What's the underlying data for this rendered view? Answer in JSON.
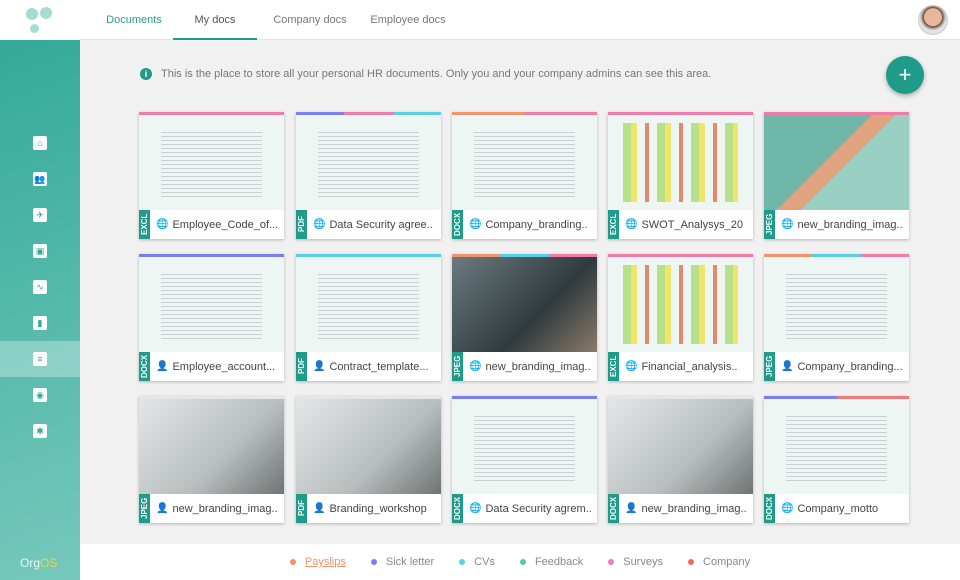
{
  "app": {
    "brand_prefix": "Org",
    "brand_suffix": "OS"
  },
  "header": {
    "section": "Documents",
    "tabs": [
      {
        "label": "My docs",
        "active": true
      },
      {
        "label": "Company docs"
      },
      {
        "label": "Employee docs"
      }
    ]
  },
  "sidebar": {
    "items": [
      {
        "icon": "home-icon"
      },
      {
        "icon": "people-icon"
      },
      {
        "icon": "airplane-icon"
      },
      {
        "icon": "dashboard-icon"
      },
      {
        "icon": "activity-icon"
      },
      {
        "icon": "bar-chart-icon"
      },
      {
        "icon": "documents-icon",
        "active": true
      },
      {
        "icon": "id-badge-icon"
      },
      {
        "icon": "settings-icon"
      }
    ]
  },
  "info": {
    "text": "This is the place to store all your personal HR documents. Only you and your company admins can see this area."
  },
  "add_button": "+",
  "cards": [
    {
      "type": "EXCL",
      "scope": "globe",
      "name": "Employee_Code_of...",
      "thumb": "document",
      "bars": [
        "#f07aa8"
      ]
    },
    {
      "type": "PDF",
      "scope": "globe",
      "name": "Data Security agree..",
      "thumb": "document",
      "bars": [
        "#7b7ef0",
        "#f07aa8",
        "#5ccfe6"
      ]
    },
    {
      "type": "DOCX",
      "scope": "globe",
      "name": "Company_branding..",
      "thumb": "document",
      "bars": [
        "#f0946b",
        "#f07aa8"
      ]
    },
    {
      "type": "EXCL",
      "scope": "globe",
      "name": "SWOT_Analysys_20",
      "thumb": "spreadsheet",
      "bars": [
        "#f07aa8"
      ]
    },
    {
      "type": "JPEG",
      "scope": "globe",
      "name": "new_branding_imag..",
      "thumb": "graphic",
      "bars": [
        "#f07aa8"
      ]
    },
    {
      "type": "DOCX",
      "scope": "person",
      "name": "Employee_account...",
      "thumb": "document",
      "bars": [
        "#7b7ef0"
      ]
    },
    {
      "type": "PDF",
      "scope": "person",
      "name": "Contract_template...",
      "thumb": "document",
      "bars": [
        "#5ccfe6"
      ]
    },
    {
      "type": "JPEG",
      "scope": "globe",
      "name": "new_branding_imag..",
      "thumb": "photo",
      "bars": [
        "#f0946b",
        "#5ccfe6",
        "#f07aa8"
      ]
    },
    {
      "type": "EXCL",
      "scope": "globe",
      "name": "Financial_analysis..",
      "thumb": "spreadsheet",
      "bars": [
        "#f07aa8"
      ]
    },
    {
      "type": "JPEG",
      "scope": "person",
      "name": "Company_branding...",
      "thumb": "document",
      "bars": [
        "#f0946b",
        "#5ccfe6",
        "#f07aa8"
      ]
    },
    {
      "type": "JPEG",
      "scope": "person",
      "name": "new_branding_imag..",
      "thumb": "photo-light",
      "bars": [
        "#e6e6e6"
      ]
    },
    {
      "type": "PDF",
      "scope": "person",
      "name": "Branding_workshop",
      "thumb": "photo-light",
      "bars": [
        "#e6e6e6"
      ]
    },
    {
      "type": "DOCX",
      "scope": "globe",
      "name": "Data Security agrem..",
      "thumb": "document",
      "bars": [
        "#7b7ef0"
      ]
    },
    {
      "type": "DOCX",
      "scope": "person",
      "name": "new_branding_imag..",
      "thumb": "photo-light",
      "bars": [
        "#e6e6e6"
      ]
    },
    {
      "type": "DOCX",
      "scope": "globe",
      "name": "Company_motto",
      "thumb": "document",
      "bars": [
        "#7b7ef0",
        "#f07a7a"
      ]
    }
  ],
  "legend": [
    {
      "label": "Payslips",
      "color": "#f0946b"
    },
    {
      "label": "Sick letter",
      "color": "#7b7ef0"
    },
    {
      "label": "CVs",
      "color": "#5ccfe6"
    },
    {
      "label": "Feedback",
      "color": "#4ccf98"
    },
    {
      "label": "Surveys",
      "color": "#f07ab8"
    },
    {
      "label": "Company",
      "color": "#f06a5a"
    }
  ]
}
